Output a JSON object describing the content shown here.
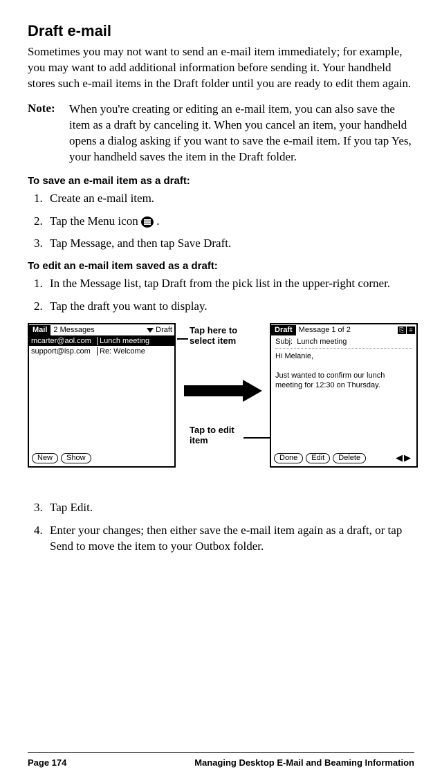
{
  "heading": "Draft e-mail",
  "intro": "Sometimes you may not want to send an e-mail item immediately; for example, you may want to add additional information before sending it. Your handheld stores such e-mail items in the Draft folder until you are ready to edit them again.",
  "note": {
    "label": "Note:",
    "text": "When you're creating or editing an e-mail item, you can also save the item as a draft by canceling it. When you cancel an item, your handheld opens a dialog asking if you want to save the e-mail item. If you tap Yes, your handheld saves the item in the Draft folder."
  },
  "proc1": {
    "heading": "To save an e-mail item as a draft:",
    "steps": [
      "Create an e-mail item.",
      "Tap the Menu icon ",
      "Tap Message, and then tap Save Draft."
    ],
    "step2_suffix": " ."
  },
  "proc2": {
    "heading": "To edit an e-mail item saved as a draft:",
    "steps": [
      "In the Message list, tap Draft from the pick list in the upper-right corner.",
      "Tap the draft you want to display.",
      "Tap Edit.",
      "Enter your changes; then either save the e-mail item again as a draft, or tap Send to move the item to your Outbox folder."
    ]
  },
  "annotations": {
    "select_item": "Tap here to select item",
    "edit_item": "Tap to edit item"
  },
  "screen_left": {
    "app": "Mail",
    "title": "2 Messages",
    "picklist": "Draft",
    "rows": [
      {
        "from": "mcarter@aol.com",
        "subj": "Lunch meeting",
        "selected": true
      },
      {
        "from": "support@isp.com",
        "subj": "Re: Welcome",
        "selected": false
      }
    ],
    "buttons": [
      "New",
      "Show"
    ]
  },
  "screen_right": {
    "app": "Draft",
    "title": "Message 1 of 2",
    "subj_label": "Subj:",
    "subj": "Lunch meeting",
    "body_greeting": "Hi Melanie,",
    "body_text": "Just wanted to confirm our lunch meeting for 12:30 on Thursday.",
    "buttons": [
      "Done",
      "Edit",
      "Delete"
    ]
  },
  "footer": {
    "page": "Page 174",
    "chapter": "Managing Desktop E-Mail and Beaming Information"
  }
}
